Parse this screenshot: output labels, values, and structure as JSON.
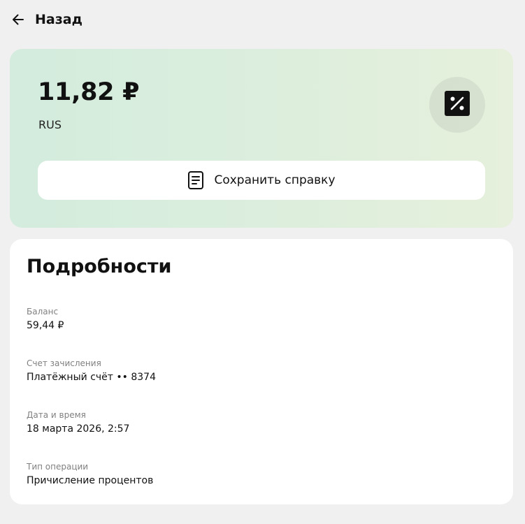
{
  "header": {
    "back_label": "Назад"
  },
  "operation": {
    "amount": "11,82 ₽",
    "currency": "RUS",
    "badge_icon": "percent-icon",
    "save_label": "Сохранить справку"
  },
  "details": {
    "title": "Подробности",
    "items": [
      {
        "label": "Баланс",
        "value": "59,44 ₽"
      },
      {
        "label": "Счет зачисления",
        "value": "Платёжный счёт •• 8374"
      },
      {
        "label": "Дата и время",
        "value": "18 марта 2026, 2:57"
      },
      {
        "label": "Тип операции",
        "value": "Причисление процентов"
      }
    ]
  },
  "colors": {
    "page_background": "#f0f0f0",
    "card_gradient_start": "#d3ecdd",
    "card_gradient_end": "#e6f0dc",
    "text_primary": "#111111",
    "text_secondary": "#808080"
  }
}
